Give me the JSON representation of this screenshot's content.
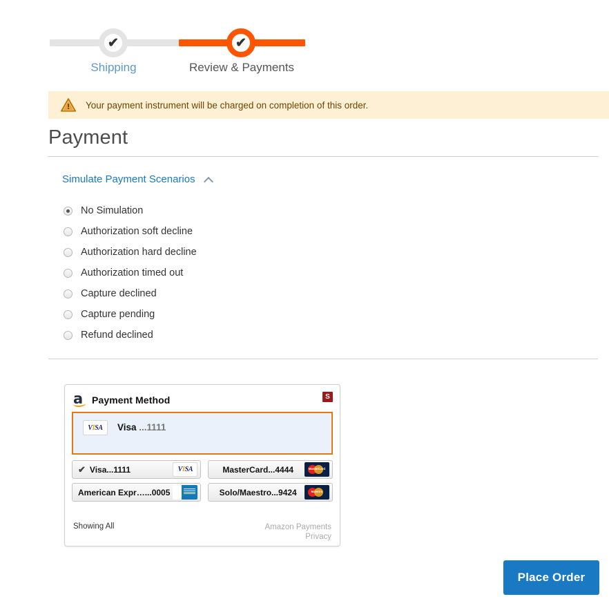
{
  "checkout_progress": {
    "steps": [
      {
        "label": "Shipping",
        "state": "complete",
        "check": "✔"
      },
      {
        "label": "Review & Payments",
        "state": "current",
        "check": "✔"
      }
    ]
  },
  "notice": {
    "icon": "warning-triangle-icon",
    "message": "Your payment instrument will be charged on completion of this order."
  },
  "page": {
    "title": "Payment"
  },
  "simulate": {
    "toggle_label": "Simulate Payment Scenarios",
    "toggle_icon": "chevron-up-icon",
    "options": [
      {
        "label": "No Simulation",
        "selected": true
      },
      {
        "label": "Authorization soft decline",
        "selected": false
      },
      {
        "label": "Authorization hard decline",
        "selected": false
      },
      {
        "label": "Authorization timed out",
        "selected": false
      },
      {
        "label": "Capture declined",
        "selected": false
      },
      {
        "label": "Capture pending",
        "selected": false
      },
      {
        "label": "Refund declined",
        "selected": false
      }
    ]
  },
  "amazon_widget": {
    "logo": "amazon-logo",
    "title": "Payment Method",
    "sandbox_badge": "S",
    "selected_card": {
      "brand": "Visa",
      "masked": "...1111",
      "logo": "visa-logo"
    },
    "cards": [
      {
        "name": "Visa...1111",
        "brand": "Visa",
        "masked": "...1111",
        "logo": "visa-logo",
        "selected": true,
        "check": "✔"
      },
      {
        "name": "MasterCard...4444",
        "brand": "MasterCard",
        "masked": "...4444",
        "logo": "mastercard-logo",
        "selected": false,
        "check": ""
      },
      {
        "name": "American Expr…...0005",
        "brand": "American Expr",
        "masked": "...0005",
        "logo": "amex-logo",
        "selected": false,
        "check": ""
      },
      {
        "name": "Solo/Maestro...9424",
        "brand": "Solo/Maestro",
        "masked": "...9424",
        "logo": "maestro-logo",
        "selected": false,
        "check": ""
      }
    ],
    "showing_all": "Showing All",
    "footer_links": [
      "Amazon Payments",
      "Privacy"
    ]
  },
  "actions": {
    "place_order": "Place Order"
  },
  "colors": {
    "accent_orange": "#ff5501",
    "link_blue": "#1979c3",
    "button_blue": "#1979c3",
    "notice_bg": "#fdf0d5",
    "notice_text": "#6f4400",
    "amazon_orange_border": "#e47911",
    "selected_panel_bg": "#eaf1fb",
    "sandbox_red": "#a01818"
  }
}
